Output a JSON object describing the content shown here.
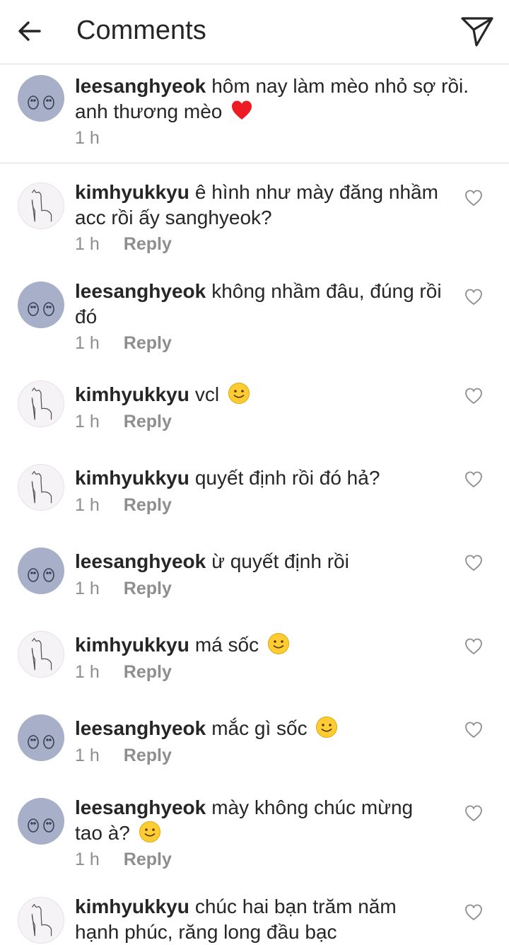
{
  "header": {
    "title": "Comments",
    "back_icon": "arrow-left-icon",
    "send_icon": "paper-plane-icon"
  },
  "caption": {
    "username": "leesanghyeok",
    "text": "hôm nay làm mèo nhỏ sợ rồi. anh thương mèo",
    "emoji": "red-heart",
    "time": "1 h"
  },
  "comments": [
    {
      "username": "kimhyukkyu",
      "text": "ê hình như mày đăng nhầm acc rồi ấy sanghyeok?",
      "time": "1 h",
      "reply": "Reply",
      "emoji": ""
    },
    {
      "username": "leesanghyeok",
      "text": "không nhầm đâu, đúng rồi đó",
      "time": "1 h",
      "reply": "Reply",
      "emoji": ""
    },
    {
      "username": "kimhyukkyu",
      "text": "vcl",
      "time": "1 h",
      "reply": "Reply",
      "emoji": "slight-smile"
    },
    {
      "username": "kimhyukkyu",
      "text": "quyết định rồi đó hả?",
      "time": "1 h",
      "reply": "Reply",
      "emoji": ""
    },
    {
      "username": "leesanghyeok",
      "text": "ừ quyết định rồi",
      "time": "1 h",
      "reply": "Reply",
      "emoji": ""
    },
    {
      "username": "kimhyukkyu",
      "text": "má sốc",
      "time": "1 h",
      "reply": "Reply",
      "emoji": "slight-smile"
    },
    {
      "username": "leesanghyeok",
      "text": "mắc gì sốc",
      "time": "1 h",
      "reply": "Reply",
      "emoji": "slight-smile"
    },
    {
      "username": "leesanghyeok",
      "text": "mày không chúc mừng tao à?",
      "time": "1 h",
      "reply": "Reply",
      "emoji": "slight-smile"
    },
    {
      "username": "kimhyukkyu",
      "text": "chúc hai bạn trăm năm hạnh phúc, răng long đầu bạc",
      "time": "",
      "reply": "",
      "emoji": ""
    }
  ],
  "colors": {
    "text": "#262626",
    "meta": "#8e8e8e",
    "divider": "#dbdbdb",
    "heart_emoji": "#ed1c24",
    "smile_emoji": "#ffcc33"
  }
}
